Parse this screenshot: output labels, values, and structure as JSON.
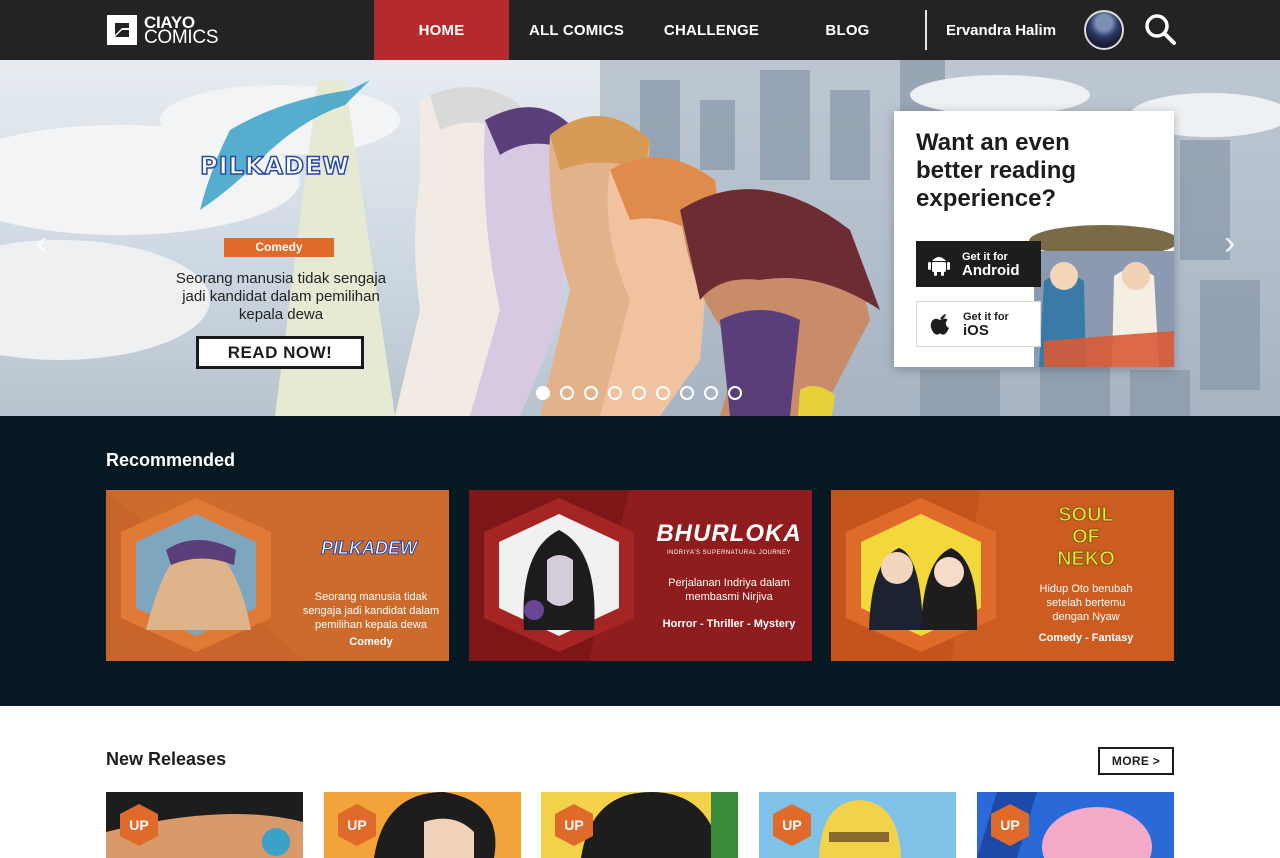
{
  "brand": {
    "line1": "CIAYO",
    "line2": "COMICS"
  },
  "nav": {
    "items": [
      {
        "label": "HOME",
        "active": true
      },
      {
        "label": "ALL COMICS",
        "active": false
      },
      {
        "label": "CHALLENGE",
        "active": false
      },
      {
        "label": "BLOG",
        "active": false
      }
    ],
    "user_name": "Ervandra Halim"
  },
  "hero": {
    "comic_logo": "PILKADEW",
    "genre": "Comedy",
    "description": "Seorang manusia tidak sengaja jadi kandidat dalam pemilihan kepala dewa",
    "cta": "READ NOW!",
    "slide_count": 9,
    "active_slide": 0,
    "app_card": {
      "title": "Want an even better reading experience?",
      "android_top": "Get it for",
      "android_bottom": "Android",
      "ios_top": "Get it for",
      "ios_bottom": "iOS"
    }
  },
  "recommended": {
    "title": "Recommended",
    "cards": [
      {
        "logo": "PILKADEW",
        "description": "Seorang manusia tidak sengaja jadi kandidat dalam pemilihan kepala dewa",
        "genres": "Comedy"
      },
      {
        "logo": "BHURLOKA",
        "subtitle": "INDRIYA'S SUPERNATURAL JOURNEY",
        "description": "Perjalanan Indriya dalam membasmi Nirjiva",
        "genres": "Horror - Thriller - Mystery"
      },
      {
        "logo_line1": "SOUL",
        "logo_line2": "OF",
        "logo_line3": "NEKO",
        "description": "Hidup Oto berubah setelah bertemu dengan Nyaw",
        "genres": "Comedy - Fantasy"
      }
    ]
  },
  "new_releases": {
    "title": "New Releases",
    "more": "MORE >",
    "badge": "UP",
    "cards": [
      {
        "badge": "UP"
      },
      {
        "badge": "UP"
      },
      {
        "badge": "UP"
      },
      {
        "badge": "UP"
      },
      {
        "badge": "UP"
      }
    ]
  }
}
